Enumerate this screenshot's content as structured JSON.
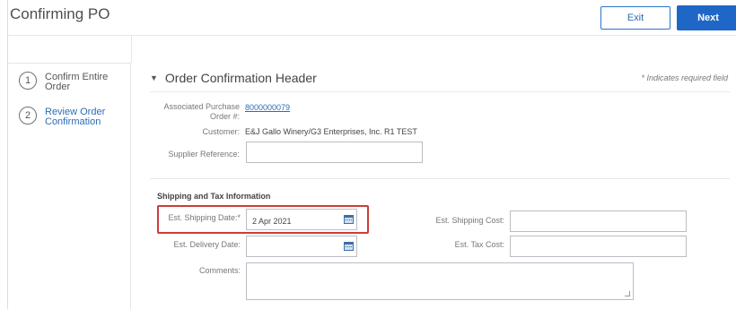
{
  "header": {
    "title": "Confirming PO",
    "exit_label": "Exit",
    "next_label": "Next"
  },
  "sidebar": {
    "steps": [
      {
        "number": "1",
        "label": "Confirm Entire Order",
        "active": false
      },
      {
        "number": "2",
        "label": "Review Order Confirmation",
        "active": true
      }
    ]
  },
  "section": {
    "title": "Order Confirmation Header",
    "required_note": "* Indicates required field",
    "associated_po_label": "Associated Purchase Order #:",
    "associated_po_value": "8000000079",
    "customer_label": "Customer:",
    "customer_value": "E&J Gallo Winery/G3 Enterprises, Inc. R1 TEST",
    "supplier_reference_label": "Supplier Reference:",
    "supplier_reference_value": ""
  },
  "shipping": {
    "title": "Shipping and Tax Information",
    "est_shipping_date_label": "Est. Shipping Date:*",
    "est_shipping_date_value": "2 Apr 2021",
    "est_delivery_date_label": "Est. Delivery Date:",
    "est_delivery_date_value": "",
    "comments_label": "Comments:",
    "comments_value": "",
    "est_shipping_cost_label": "Est. Shipping Cost:",
    "est_shipping_cost_value": "",
    "est_tax_cost_label": "Est. Tax Cost:",
    "est_tax_cost_value": ""
  },
  "colors": {
    "accent": "#1f67c7",
    "link": "#2b6cb8",
    "highlight": "#cf3b3b"
  },
  "icons": {
    "calendar": "calendar-icon",
    "caret": "caret-down-icon"
  }
}
